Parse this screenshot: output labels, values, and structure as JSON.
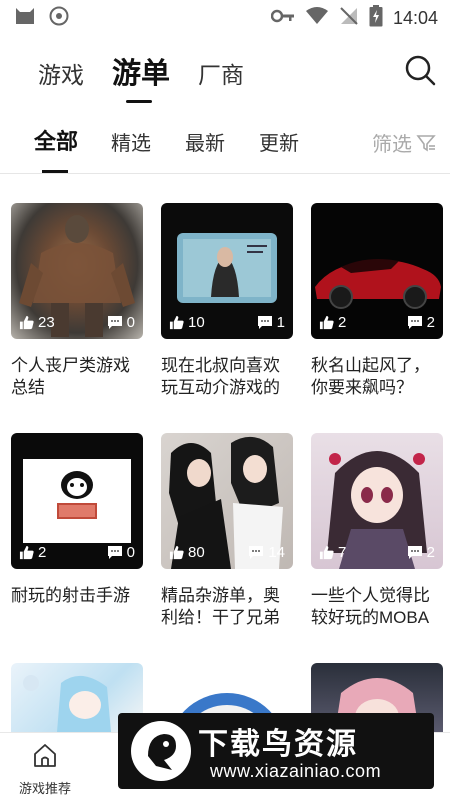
{
  "status_bar": {
    "time": "14:04"
  },
  "top_tabs": {
    "items": [
      "游戏",
      "游单",
      "厂商"
    ],
    "active": "游单"
  },
  "sub_tabs": {
    "items": [
      "全部",
      "精选",
      "最新",
      "更新"
    ],
    "active": "全部",
    "filter_label": "筛选"
  },
  "cards": [
    {
      "title": "个人丧尸类游戏总结",
      "likes": "23",
      "comments": "0"
    },
    {
      "title": "现在北叔向喜欢玩互动介游戏的",
      "likes": "10",
      "comments": "1"
    },
    {
      "title": "秋名山起风了，你要来飙吗？",
      "likes": "2",
      "comments": "2"
    },
    {
      "title": "耐玩的射击手游",
      "likes": "2",
      "comments": "0"
    },
    {
      "title": "精品杂游单，奥利给！干了兄弟",
      "likes": "80",
      "comments": "14"
    },
    {
      "title": "一些个人觉得比较好玩的MOBA",
      "likes": "7",
      "comments": "2"
    }
  ],
  "bottom_nav": {
    "items": [
      "游戏推荐"
    ]
  },
  "watermark": {
    "title": "下载鸟资源",
    "url": "www.xiazainiao.com"
  },
  "colors": {
    "accent": "#111111",
    "muted": "#aaaaaa",
    "divider": "#e6e6e6"
  }
}
